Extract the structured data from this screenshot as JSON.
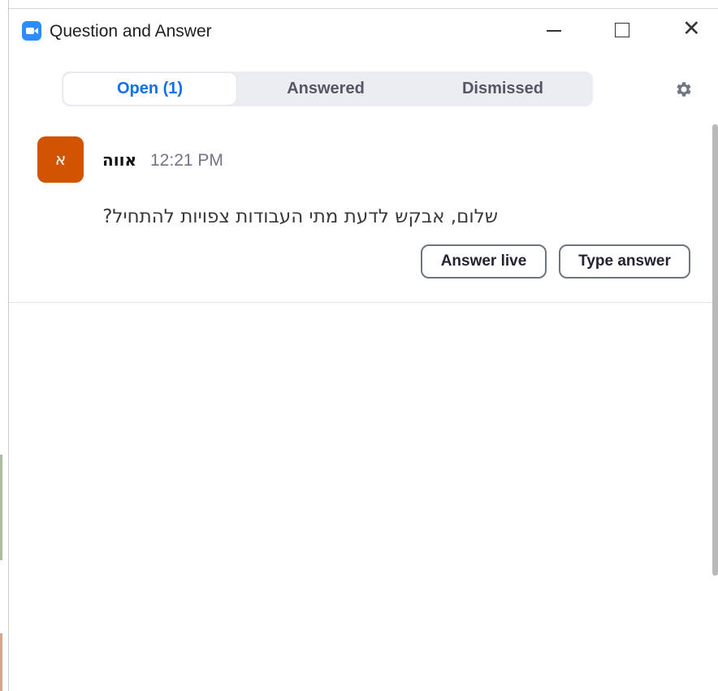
{
  "window": {
    "title": "Question and Answer",
    "app_icon": "zoom-video-icon"
  },
  "title_controls": {
    "minimize_icon": "minimize-icon",
    "maximize_icon": "maximize-icon",
    "close_icon": "close-icon",
    "close_glyph": "✕"
  },
  "tabs": [
    {
      "label": "Open (1)",
      "selected": true
    },
    {
      "label": "Answered",
      "selected": false
    },
    {
      "label": "Dismissed",
      "selected": false
    }
  ],
  "settings_icon": "gear-icon",
  "questions": [
    {
      "avatar_initial": "א",
      "avatar_color": "#d35400",
      "asker": "אווה",
      "time": "12:21 PM",
      "text": "שלום, אבקש לדעת מתי העבודות צפויות להתחיל?",
      "actions": {
        "answer_live": "Answer live",
        "type_answer": "Type answer"
      }
    }
  ],
  "colors": {
    "accent": "#0e71eb",
    "tab_bg": "#ecedf2",
    "muted_text": "#747487"
  }
}
